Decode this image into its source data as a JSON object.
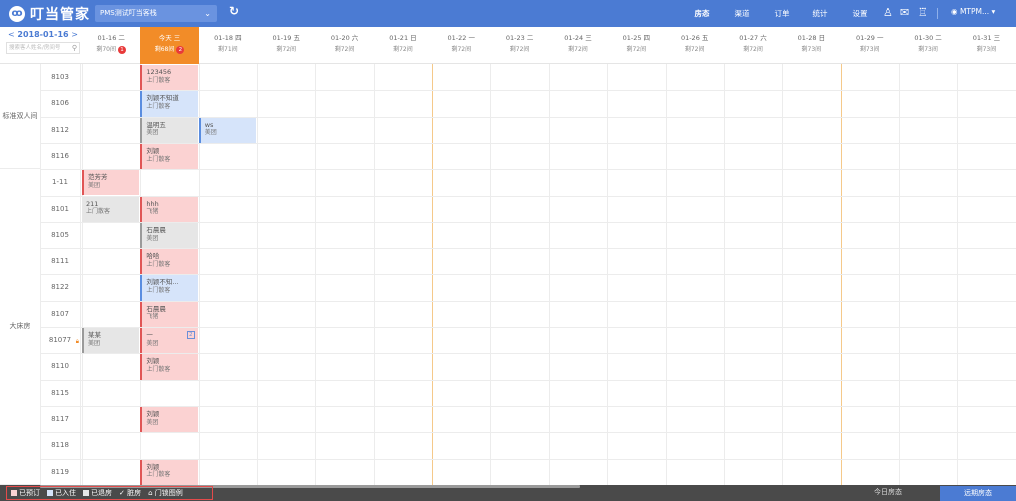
{
  "topbar": {
    "logo_mark": "ꝏ",
    "logo_text": "叮当管家",
    "store": "PMS测试叮当客栈",
    "nav": [
      "房态",
      "渠道",
      "订单",
      "统计",
      "设置"
    ],
    "user": "MTPM..."
  },
  "datepick": {
    "date": "2018-01-16",
    "prev": "<",
    "next": ">",
    "search_placeholder": "搜索客人姓名/房间号"
  },
  "dates": [
    {
      "label": "01-16 二",
      "count": "剩70间",
      "badge": "1"
    },
    {
      "label": "今天 三",
      "count": "剩68间",
      "badge": "2",
      "today": true
    },
    {
      "label": "01-18 四",
      "count": "剩71间"
    },
    {
      "label": "01-19 五",
      "count": "剩72间"
    },
    {
      "label": "01-20 六",
      "count": "剩72间"
    },
    {
      "label": "01-21 日",
      "count": "剩72间"
    },
    {
      "label": "01-22 一",
      "count": "剩72间"
    },
    {
      "label": "01-23 二",
      "count": "剩72间"
    },
    {
      "label": "01-24 三",
      "count": "剩72间"
    },
    {
      "label": "01-25 四",
      "count": "剩72间"
    },
    {
      "label": "01-26 五",
      "count": "剩72间"
    },
    {
      "label": "01-27 六",
      "count": "剩72间"
    },
    {
      "label": "01-28 日",
      "count": "剩73间"
    },
    {
      "label": "01-29 一",
      "count": "剩73间"
    },
    {
      "label": "01-30 二",
      "count": "剩73间"
    },
    {
      "label": "01-31 三",
      "count": "剩73间"
    }
  ],
  "room_types": [
    {
      "name": "标准双人间"
    },
    {
      "name": "大床房"
    }
  ],
  "rooms": [
    "8103",
    "8106",
    "8112",
    "8116",
    "1-11",
    "8101",
    "8105",
    "8111",
    "8122",
    "8107",
    "81077",
    "8110",
    "8115",
    "8117",
    "8118",
    "8119"
  ],
  "bookings": [
    {
      "room": 0,
      "day": 1,
      "name": "123456",
      "source": "上门散客",
      "color": "pink"
    },
    {
      "room": 1,
      "day": 1,
      "name": "刘颖不知道",
      "source": "上门散客",
      "color": "blue"
    },
    {
      "room": 2,
      "day": 1,
      "name": "温明五",
      "source": "美团",
      "color": "gray"
    },
    {
      "room": 2,
      "day": 2,
      "name": "ws",
      "source": "美团",
      "color": "blue"
    },
    {
      "room": 3,
      "day": 1,
      "name": "刘颖",
      "source": "上门散客",
      "color": "pink"
    },
    {
      "room": 4,
      "day": 0,
      "name": "范芳芳",
      "source": "美团",
      "color": "pink"
    },
    {
      "room": 5,
      "day": 0,
      "name": "211",
      "source": "上门散客",
      "color": "gray-plain"
    },
    {
      "room": 5,
      "day": 1,
      "name": "hhh",
      "source": "飞猪",
      "color": "pink"
    },
    {
      "room": 6,
      "day": 1,
      "name": "石晨晨",
      "source": "美团",
      "color": "gray"
    },
    {
      "room": 7,
      "day": 1,
      "name": "哈哈",
      "source": "上门散客",
      "color": "pink"
    },
    {
      "room": 8,
      "day": 1,
      "name": "刘颖不知...",
      "source": "上门散客",
      "color": "blue"
    },
    {
      "room": 9,
      "day": 1,
      "name": "石晨晨",
      "source": "飞猪",
      "color": "pink"
    },
    {
      "room": 10,
      "day": 0,
      "name": "某某",
      "source": "美团",
      "color": "gray"
    },
    {
      "room": 10,
      "day": 1,
      "name": "一",
      "source": "美团",
      "color": "pink",
      "badge": "2"
    },
    {
      "room": 11,
      "day": 1,
      "name": "刘颖",
      "source": "上门散客",
      "color": "pink"
    },
    {
      "room": 13,
      "day": 1,
      "name": "刘颖",
      "source": "美团",
      "color": "pink"
    },
    {
      "room": 15,
      "day": 1,
      "name": "刘颖",
      "source": "上门散客",
      "color": "pink"
    }
  ],
  "legend": [
    "已预订",
    "已入住",
    "已退房",
    "脏房",
    "门锁图例"
  ],
  "bottom": {
    "btn1": "今日房态",
    "btn2": "远期房态"
  },
  "colors": {
    "primary": "#4b7bd3",
    "today": "#f28c28",
    "pink": "#fbd2d2",
    "blue": "#d6e4fa",
    "gray": "#e6e6e6"
  }
}
